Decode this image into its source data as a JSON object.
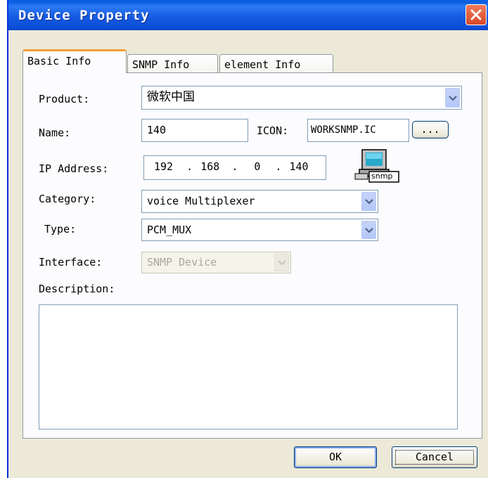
{
  "window": {
    "title": "Device Property"
  },
  "tabs": [
    {
      "label": "Basic Info",
      "active": true
    },
    {
      "label": "SNMP Info",
      "active": false
    },
    {
      "label": "element Info",
      "active": false
    }
  ],
  "form": {
    "product_label": "Product:",
    "product_value": "微软中国",
    "name_label": "Name:",
    "name_value": "140",
    "icon_label": "ICON:",
    "icon_value": "WORKSNMP.IC",
    "browse_label": "...",
    "ip_label": "IP Address:",
    "ip_octets": [
      "192",
      "168",
      "0",
      "140"
    ],
    "ip_dot": ".",
    "snmp_icon_label": "snmp",
    "category_label": "Category:",
    "category_value": "voice Multiplexer",
    "type_label": "Type:",
    "type_value": "PCM_MUX",
    "interface_label": "Interface:",
    "interface_value": "SNMP Device",
    "description_label": "Description:",
    "description_value": ""
  },
  "buttons": {
    "ok": "OK",
    "cancel": "Cancel"
  },
  "colors": {
    "titlebar": "#0a5fe6",
    "dialog_bg": "#ece9d8",
    "active_tab_accent": "#f0a030",
    "close_button": "#d84a28"
  }
}
